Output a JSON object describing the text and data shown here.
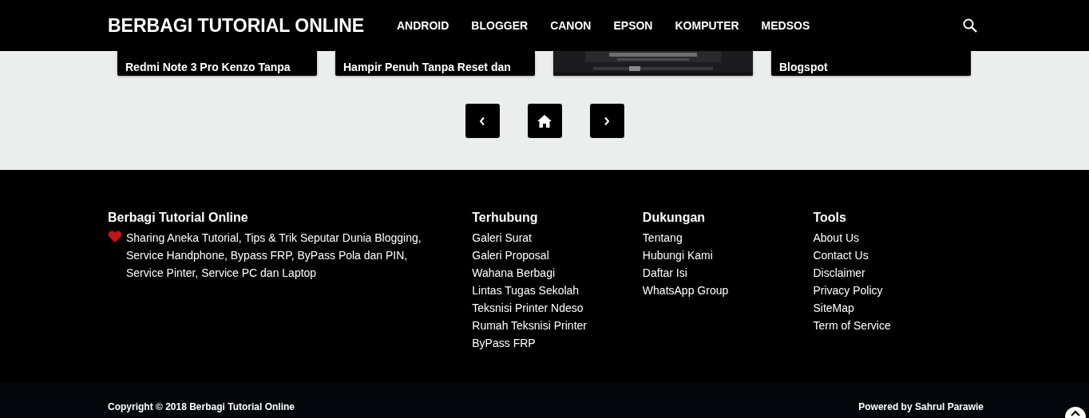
{
  "header": {
    "logo": "BERBAGI TUTORIAL ONLINE",
    "nav": [
      "ANDROID",
      "BLOGGER",
      "CANON",
      "EPSON",
      "KOMPUTER",
      "MEDSOS"
    ]
  },
  "cards": [
    {
      "kind": "text",
      "lines": [
        "Redmi Note 3 Pro Kenzo Tanpa"
      ]
    },
    {
      "kind": "text",
      "lines": [
        "Hampir Penuh Tanpa Reset dan"
      ]
    },
    {
      "kind": "picture"
    },
    {
      "kind": "text",
      "lines": [
        "Blogspot"
      ]
    }
  ],
  "footer": {
    "about": {
      "title": "Berbagi Tutorial Online",
      "text": "Sharing Aneka Tutorial, Tips & Trik Seputar Dunia Blogging, Service Handphone, Bypass FRP, ByPass Pola dan PIN, Service Pinter, Service PC dan Laptop"
    },
    "columns": [
      {
        "title": "Terhubung",
        "links": [
          "Galeri Surat",
          "Galeri Proposal",
          "Wahana Berbagi",
          "Lintas Tugas Sekolah",
          "Teksnisi Printer Ndeso",
          "Rumah Teksnisi Printer",
          "ByPass FRP"
        ]
      },
      {
        "title": "Dukungan",
        "links": [
          "Tentang",
          "Hubungi Kami",
          "Daftar Isi",
          "WhatsApp Group"
        ]
      },
      {
        "title": "Tools",
        "links": [
          "About Us",
          "Contact Us",
          "Disclaimer",
          "Privacy Policy",
          "SiteMap",
          "Term of Service"
        ]
      }
    ]
  },
  "bottom_bar": {
    "copyright": "Copyright © 2018 Berbagi Tutorial Online",
    "powered": "Powered by **Sahrul Parawie**"
  }
}
